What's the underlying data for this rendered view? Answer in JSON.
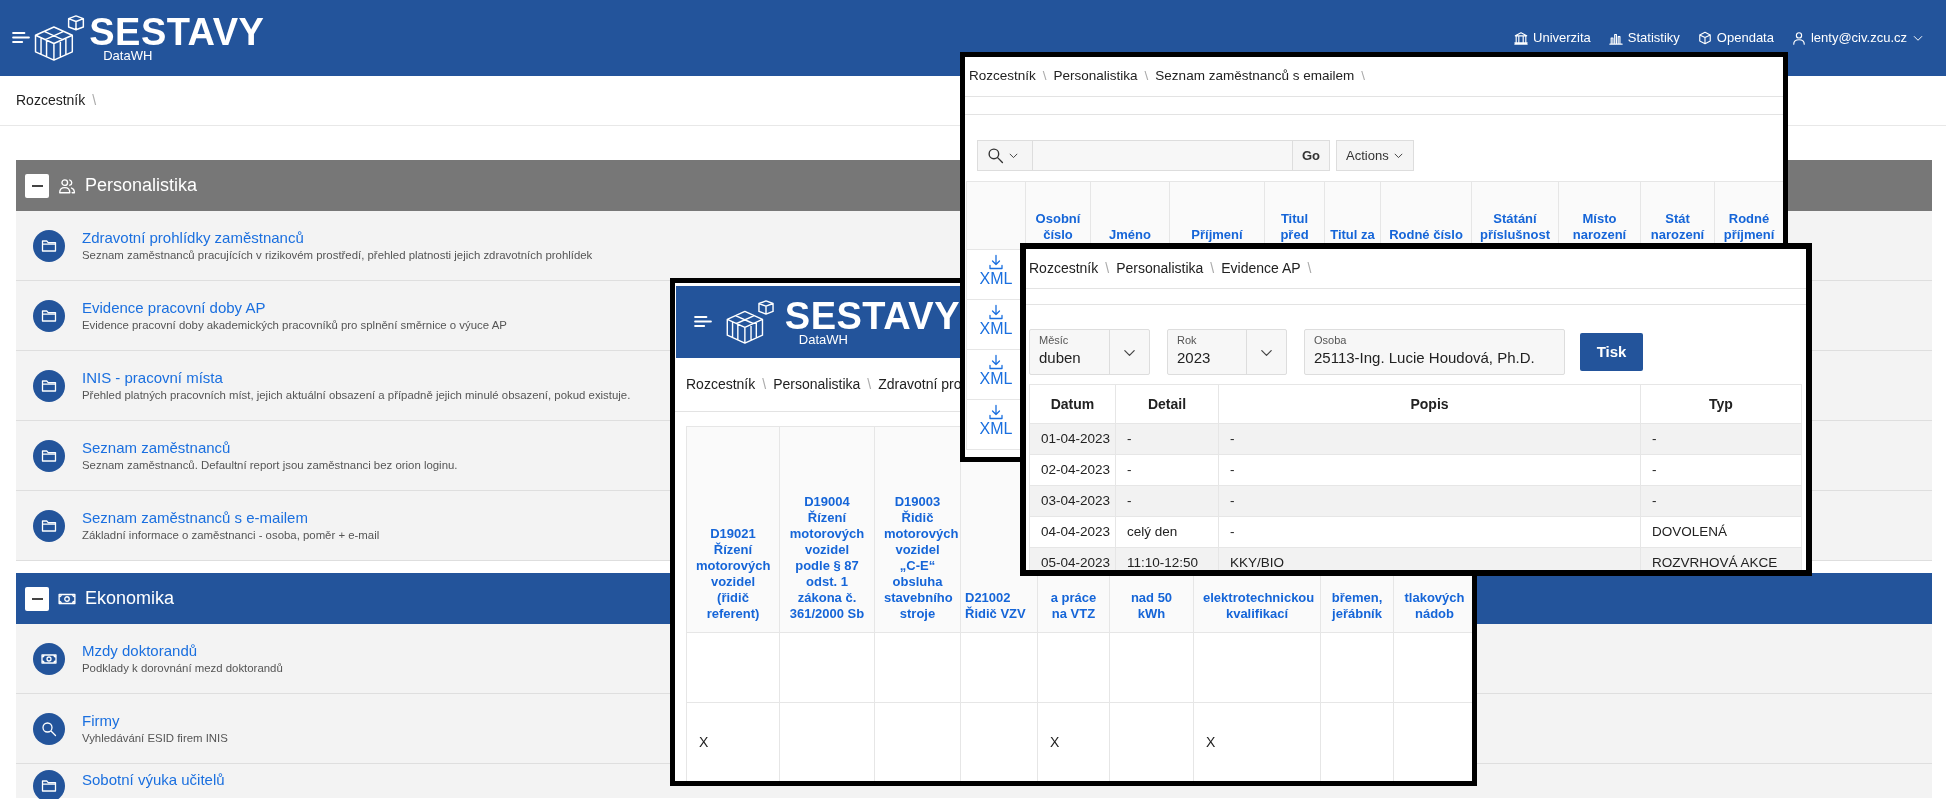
{
  "header": {
    "brand": "SESTAVY",
    "brand_subtitle": "DataWH",
    "links": [
      {
        "label": "Univerzita",
        "kind": "building"
      },
      {
        "label": "Statistiky",
        "kind": "chart"
      },
      {
        "label": "Opendata",
        "kind": "cube"
      }
    ],
    "user": "lenty@civ.zcu.cz"
  },
  "breadcrumb": [
    {
      "label": "Rozcestník",
      "separator": "\\"
    }
  ],
  "sections": [
    {
      "title": "Personalistika",
      "kind": "people",
      "color": "#777777",
      "items": [
        {
          "title": "Zdravotní prohlídky zaměstnanců",
          "description": "Seznam zaměstnanců pracujících v rizikovém prostředí, přehled platnosti jejich zdravotních prohlídek",
          "kind": "folder"
        },
        {
          "title": "Evidence pracovní doby AP",
          "description": "Evidence pracovní doby akademických pracovníků pro splnění směrnice o výuce AP",
          "kind": "folder"
        },
        {
          "title": "INIS - pracovní místa",
          "description": "Přehled platných pracovních míst, jejich aktuální obsazení a případně jejich minulé obsazení, pokud existuje.",
          "kind": "folder"
        },
        {
          "title": "Seznam zaměstnanců",
          "description": "Seznam zaměstnanců. Defaultní report jsou zaměstnanci bez orion loginu.",
          "kind": "folder"
        },
        {
          "title": "Seznam zaměstnanců s e-mailem",
          "description": "Základní informace o zaměstnanci - osoba, poměr + e-mail",
          "kind": "folder"
        }
      ]
    },
    {
      "title": "Ekonomika",
      "kind": "money",
      "color": "#23549b",
      "items": [
        {
          "title": "Mzdy doktorandů",
          "description": "Podklady k dorovnání mezd doktorandů",
          "kind": "money"
        },
        {
          "title": "Firmy",
          "description": "Vyhledávání ESID firem INIS",
          "kind": "search"
        },
        {
          "title": "Sobotní výuka učitelů",
          "kind": "folder"
        }
      ]
    }
  ],
  "health_checks_window": {
    "brand": "SESTAVY",
    "brand_subtitle": "DataWH",
    "breadcrumb": [
      {
        "label": "Rozcestník",
        "separator": "\\"
      },
      {
        "label": "Personalistika",
        "separator": "\\"
      },
      {
        "label": "Zdravotní pro"
      }
    ],
    "columns": [
      "D19021 Řízení motorových vozidel (řidič referent)",
      "D19004 Řízení motorových vozidel podle § 87 odst. 1 zákona č. 361/2000 Sb",
      "D19003 Řidič motorových vozidel „C-E“ obsluha stavebního stroje",
      "D21002 Řidič VZV",
      "a práce na VTZ",
      "nad 50 kWh",
      "elektrotechnickou kvalifikací",
      "břemen, jeřábník",
      "tlakových nádob"
    ],
    "rows": [
      {
        "kind": "empty"
      },
      {
        "kind": "data",
        "cells": {
          "column_1": "X",
          "column_5": "X",
          "column_7": "X"
        }
      }
    ]
  },
  "employees_email_window": {
    "breadcrumb": [
      {
        "label": "Rozcestník",
        "separator": "\\"
      },
      {
        "label": "Personalistika",
        "separator": "\\"
      },
      {
        "label": "Seznam zaměstnanců s emailem",
        "separator": "\\"
      }
    ],
    "go_button": "Go",
    "actions_button": "Actions",
    "columns": [
      "Osobní číslo",
      "Jméno",
      "Příjmení",
      "Titul před",
      "Titul za",
      "Rodné číslo",
      "Státání příslušnost",
      "Místo narození",
      "Stát narození",
      "Rodné příjmení"
    ],
    "download_links": [
      "XML",
      "XML",
      "XML",
      "XML"
    ]
  },
  "work_time_window": {
    "breadcrumb": [
      {
        "label": "Rozcestník",
        "separator": "\\"
      },
      {
        "label": "Personalistika",
        "separator": "\\"
      },
      {
        "label": "Evidence AP",
        "separator": "\\"
      }
    ],
    "filters": [
      {
        "kind": "select",
        "label": "Měsíc",
        "value": "duben"
      },
      {
        "kind": "select",
        "label": "Rok",
        "value": "2023"
      },
      {
        "kind": "text",
        "label": "Osoba",
        "value": "25113-Ing. Lucie Houdová, Ph.D."
      }
    ],
    "print_button": "Tisk",
    "columns": [
      "Datum",
      "Detail",
      "Popis",
      "Typ"
    ],
    "rows": [
      [
        "01-04-2023",
        "-",
        "-",
        "-"
      ],
      [
        "02-04-2023",
        "-",
        "-",
        "-"
      ],
      [
        "03-04-2023",
        "-",
        "-",
        "-"
      ],
      [
        "04-04-2023",
        "celý den",
        "-",
        "DOVOLENÁ"
      ],
      [
        "05-04-2023",
        "11:10-12:50",
        "KKY/BIO",
        "ROZVRHOVÁ AKCE"
      ]
    ]
  }
}
